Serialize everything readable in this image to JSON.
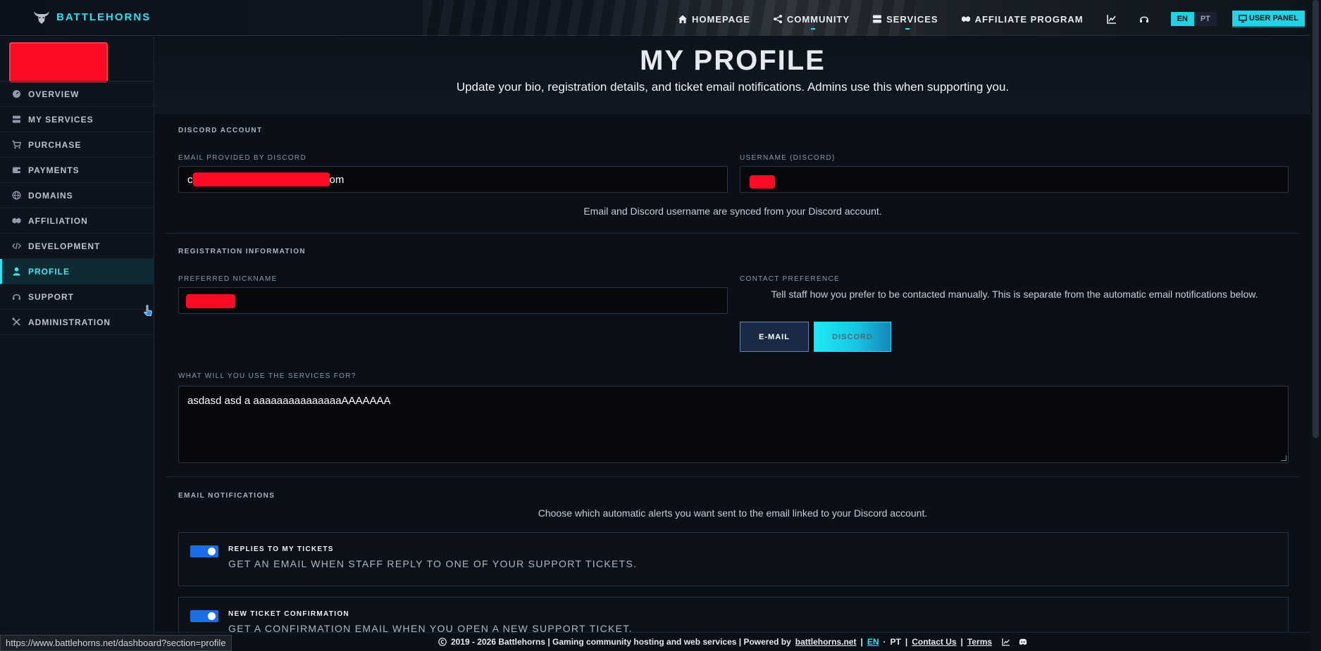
{
  "brand": {
    "name": "BATTLEHORNS"
  },
  "nav": {
    "items": [
      {
        "label": "HOMEPAGE",
        "icon": "home-icon"
      },
      {
        "label": "COMMUNITY",
        "icon": "share-icon"
      },
      {
        "label": "SERVICES",
        "icon": "server-icon"
      },
      {
        "label": "AFFILIATE PROGRAM",
        "icon": "handshake-icon"
      }
    ],
    "lang_en": "EN",
    "lang_pt": "PT",
    "user_panel": "USER PANEL"
  },
  "sidebar": {
    "items": [
      {
        "label": "OVERVIEW",
        "icon": "gauge-icon",
        "active": false
      },
      {
        "label": "MY SERVICES",
        "icon": "server-icon",
        "active": false
      },
      {
        "label": "PURCHASE",
        "icon": "cart-icon",
        "active": false
      },
      {
        "label": "PAYMENTS",
        "icon": "wallet-icon",
        "active": false
      },
      {
        "label": "DOMAINS",
        "icon": "globe-icon",
        "active": false
      },
      {
        "label": "AFFILIATION",
        "icon": "handshake-icon",
        "active": false
      },
      {
        "label": "DEVELOPMENT",
        "icon": "code-icon",
        "active": false
      },
      {
        "label": "PROFILE",
        "icon": "user-icon",
        "active": true
      },
      {
        "label": "SUPPORT",
        "icon": "headset-icon",
        "active": false
      },
      {
        "label": "ADMINISTRATION",
        "icon": "tools-icon",
        "active": false
      }
    ]
  },
  "header": {
    "title": "MY PROFILE",
    "subtitle": "Update your bio, registration details, and ticket email notifications. Admins use this when supporting you."
  },
  "discord": {
    "section": "DISCORD ACCOUNT",
    "email_label": "EMAIL PROVIDED BY DISCORD",
    "email_prefix": "c",
    "email_suffix": "om",
    "username_label": "USERNAME (DISCORD)",
    "note": "Email and Discord username are synced from your Discord account."
  },
  "registration": {
    "section": "REGISTRATION INFORMATION",
    "nickname_label": "PREFERRED NICKNAME",
    "contact_label": "CONTACT PREFERENCE",
    "contact_note": "Tell staff how you prefer to be contacted manually. This is separate from the automatic email notifications below.",
    "email_button": "E-MAIL",
    "discord_button": "DISCORD",
    "usage_label": "WHAT WILL YOU USE THE SERVICES FOR?",
    "usage_value": "asdasd asd a aaaaaaaaaaaaaaaAAAAAAA"
  },
  "notifications": {
    "section": "EMAIL NOTIFICATIONS",
    "note": "Choose which automatic alerts you want sent to the email linked to your Discord account.",
    "items": [
      {
        "title": "REPLIES TO MY TICKETS",
        "desc": "GET AN EMAIL WHEN STAFF REPLY TO ONE OF YOUR SUPPORT TICKETS.",
        "enabled": true
      },
      {
        "title": "NEW TICKET CONFIRMATION",
        "desc": "GET A CONFIRMATION EMAIL WHEN YOU OPEN A NEW SUPPORT TICKET.",
        "enabled": true
      }
    ]
  },
  "footer": {
    "copyright": "2019 - 2026 Battlehorns | Gaming community hosting and web services | Powered by",
    "site": "battlehorns.net",
    "sep1": "|",
    "en": "EN",
    "dash": "·",
    "pt": "PT",
    "sep2": "|",
    "contact": "Contact Us",
    "sep3": "|",
    "terms": "Terms"
  },
  "statusbar": {
    "url": "https://www.battlehorns.net/dashboard?section=profile"
  },
  "colors": {
    "accent": "#2ee3f0",
    "toggle": "#1a6fe8",
    "redaction": "#ff0a24"
  }
}
